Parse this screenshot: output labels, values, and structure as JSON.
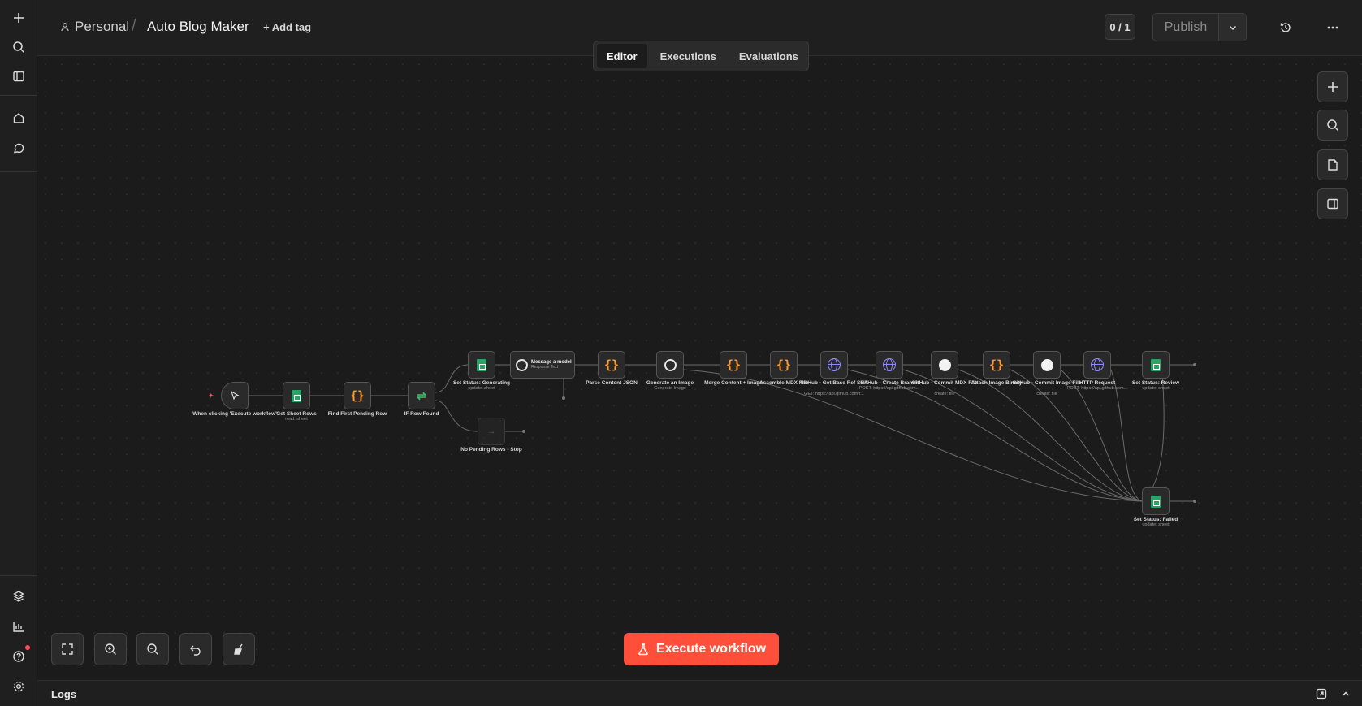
{
  "breadcrumb": {
    "project": "Personal",
    "separator": "/",
    "workflow_name": "Auto Blog Maker",
    "add_tag": "+ Add tag"
  },
  "header": {
    "counter": "0 / 1",
    "publish_label": "Publish"
  },
  "tabs": [
    {
      "label": "Editor",
      "active": true
    },
    {
      "label": "Executions",
      "active": false
    },
    {
      "label": "Evaluations",
      "active": false
    }
  ],
  "nodes": {
    "trigger": {
      "label": "When clicking 'Execute workflow'"
    },
    "get_rows": {
      "label": "Get Sheet Rows",
      "sub": "read: sheet"
    },
    "find_pending": {
      "label": "Find First Pending Row"
    },
    "if_found": {
      "label": "IF Row Found"
    },
    "no_pending": {
      "label": "No Pending Rows - Stop"
    },
    "set_generating": {
      "label": "Set Status: Generating",
      "sub": "update: sheet"
    },
    "message_model": {
      "label": "Message a model",
      "sub": "Response Text"
    },
    "parse_json": {
      "label": "Parse Content JSON"
    },
    "generate_image": {
      "label": "Generate an Image",
      "sub": "Generate Image"
    },
    "merge": {
      "label": "Merge Content + Image"
    },
    "assemble": {
      "label": "Assemble MDX File"
    },
    "gh_base": {
      "label": "GitHub - Get Base Ref SHA",
      "sub": "GET: https://api.github.com/r..."
    },
    "gh_branch": {
      "label": "GitHub - Create Branch",
      "sub": "POST: https://api.github.com..."
    },
    "gh_commit_mdx": {
      "label": "GitHub - Commit MDX File",
      "sub": "create: file"
    },
    "attach_binary": {
      "label": "Attach Image Binary"
    },
    "gh_commit_img": {
      "label": "GitHub - Commit Image File",
      "sub": "create: file"
    },
    "http_request": {
      "label": "HTTP Request",
      "sub": "POST: https://api.github.com..."
    },
    "set_review": {
      "label": "Set Status: Review",
      "sub": "update: sheet"
    },
    "set_failed": {
      "label": "Set Status: Failed",
      "sub": "update: sheet"
    }
  },
  "execute_button": "Execute workflow",
  "logs": {
    "label": "Logs"
  },
  "colors": {
    "accent": "#ff4f3b",
    "sheets": "#22a565",
    "code": "#ff9b26",
    "http": "#8e8bff",
    "if": "#36c26a"
  }
}
